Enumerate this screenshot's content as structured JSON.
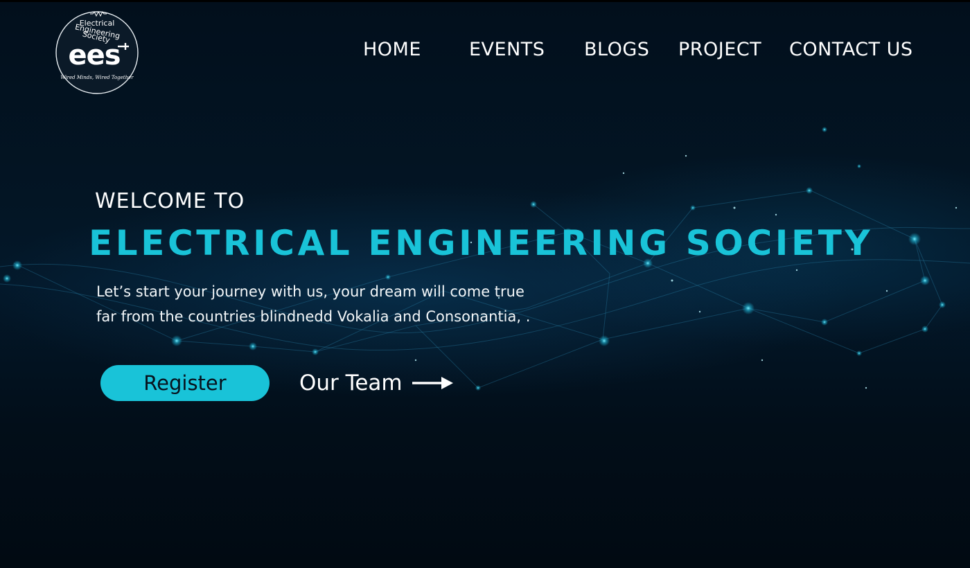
{
  "logo": {
    "acronym": "ees",
    "ring_text": "Electrical Engineering Society",
    "motto": "Wired Minds, Wired Together",
    "icon": "plug-icon"
  },
  "nav": {
    "items": [
      {
        "label": "HOME"
      },
      {
        "label": "EVENTS"
      },
      {
        "label": "BLOGS"
      },
      {
        "label": "PROJECT"
      },
      {
        "label": "CONTACT US"
      }
    ]
  },
  "hero": {
    "welcome": "WELCOME TO",
    "title": "ELECTRICAL ENGINEERING SOCIETY",
    "tagline_line1": "Let’s start your journey with us, your dream will come true",
    "tagline_line2": "far from the countries blindnedd Vokalia and Consonantia, .",
    "register_label": "Register",
    "team_label": "Our Team",
    "team_icon": "arrow-right-icon"
  },
  "colors": {
    "accent": "#19c3d8",
    "background": "#010b14",
    "text": "#ffffff"
  }
}
